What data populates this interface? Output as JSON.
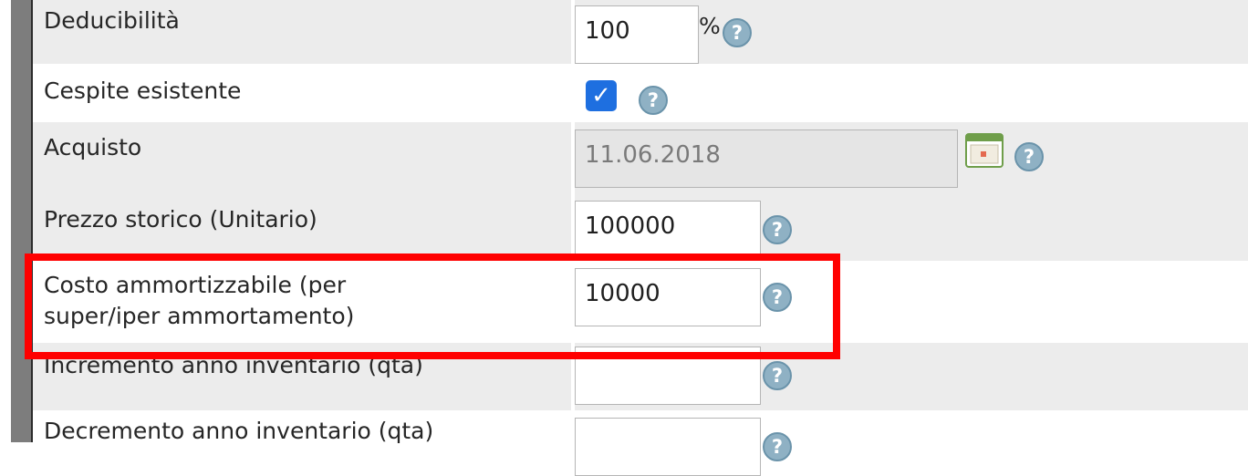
{
  "fields": [
    {
      "label": "Deducibilità",
      "value": "100",
      "suffix": "%",
      "help": "?"
    },
    {
      "label": "Cespite esistente",
      "checked": true,
      "check_glyph": "✓",
      "help": "?"
    },
    {
      "label": "Acquisto",
      "value": "11.06.2018",
      "calendar_icon": "calendar-icon",
      "help": "?"
    },
    {
      "label": "Prezzo storico (Unitario)",
      "value": "100000",
      "help": "?"
    },
    {
      "label_line1": "Costo ammortizzabile (per",
      "label_line2": "super/iper ammortamento)",
      "value": "10000",
      "help": "?"
    },
    {
      "label": "Incremento anno inventario (qta)",
      "value": "",
      "help": "?"
    },
    {
      "label": "Decremento anno inventario (qta)",
      "value": "",
      "help": "?"
    }
  ],
  "colors": {
    "highlight": "#ff0000",
    "checkbox": "#1e6fe0",
    "help_icon": "#8fb1c4",
    "row_shade": "#ececec"
  }
}
